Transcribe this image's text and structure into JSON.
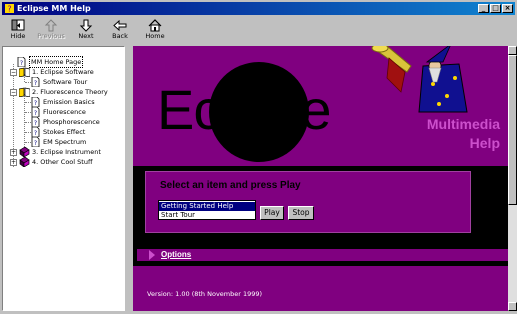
{
  "window": {
    "title": "Eclipse MM Help"
  },
  "toolbar": {
    "hide": "Hide",
    "previous": "Previous",
    "next": "Next",
    "back": "Back",
    "home": "Home"
  },
  "tree": {
    "items": [
      {
        "label": "MM Home Page"
      },
      {
        "label": "1. Eclipse Software"
      },
      {
        "label": "Software Tour"
      },
      {
        "label": "2. Fluorescence Theory"
      },
      {
        "label": "Emission Basics"
      },
      {
        "label": "Fluorescence"
      },
      {
        "label": "Phosphorescence"
      },
      {
        "label": "Stokes Effect"
      },
      {
        "label": "EM Spectrum"
      },
      {
        "label": "3. Eclipse Instrument"
      },
      {
        "label": "4. Other Cool Stuff"
      }
    ]
  },
  "banner": {
    "logo": "Eclipse",
    "subtitle1": "Multimedia",
    "subtitle2": "Help"
  },
  "play_panel": {
    "heading": "Select an item and press Play",
    "options": [
      "Getting Started Help",
      "Start Tour"
    ],
    "play_label": "Play",
    "stop_label": "Stop"
  },
  "options_bar": {
    "label": "Options"
  },
  "footer": {
    "version": "Version: 1.00 (8th November 1999)"
  },
  "colors": {
    "banner": "#800080",
    "accent_text": "#cc4fcc",
    "titlebar": "#000080",
    "selection": "#000080"
  }
}
